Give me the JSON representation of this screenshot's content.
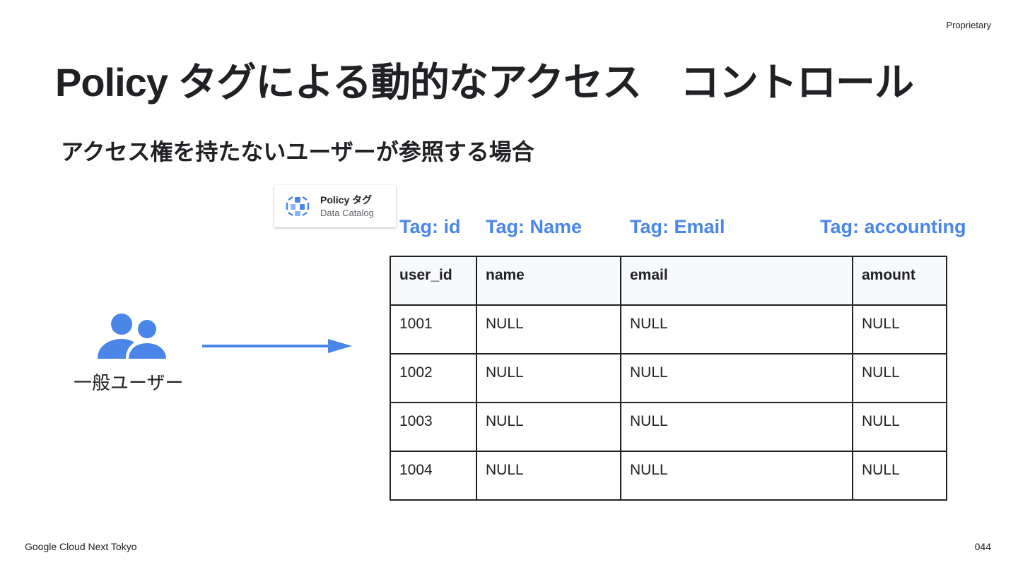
{
  "header": {
    "proprietary": "Proprietary",
    "title": "Policy タグによる動的なアクセス　コントロール",
    "subtitle": "アクセス権を持たないユーザーが参照する場合"
  },
  "catalog_card": {
    "title": "Policy タグ",
    "subtitle": "Data Catalog",
    "icon": "data-catalog-icon"
  },
  "tags": [
    "Tag: id",
    "Tag: Name",
    "Tag: Email",
    "Tag: accounting"
  ],
  "user": {
    "label": "一般ユーザー",
    "icon": "group-users-icon"
  },
  "table": {
    "headers": [
      "user_id",
      "name",
      "email",
      "amount"
    ],
    "rows": [
      [
        "1001",
        "NULL",
        "NULL",
        "NULL"
      ],
      [
        "1002",
        "NULL",
        "NULL",
        "NULL"
      ],
      [
        "1003",
        "NULL",
        "NULL",
        "NULL"
      ],
      [
        "1004",
        "NULL",
        "NULL",
        "NULL"
      ]
    ]
  },
  "footer": {
    "left": "Google Cloud Next Tokyo",
    "page_number": "044"
  },
  "colors": {
    "accent_blue": "#4a86e8",
    "text": "#202124",
    "header_bg": "#f8f9fa"
  }
}
